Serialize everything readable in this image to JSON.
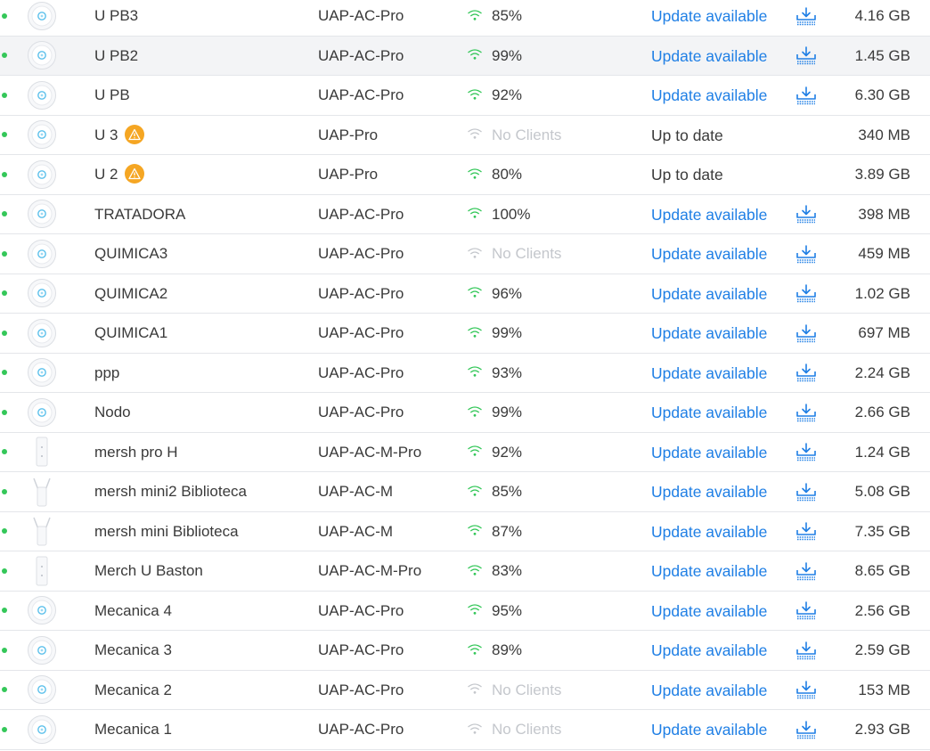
{
  "colors": {
    "online": "#34c759",
    "link": "#1f7fe5",
    "wifi_active": "#34c759",
    "wifi_empty": "#c4c7cc",
    "warning": "#f5a623",
    "row_border": "#e4e6ea",
    "row_hover": "#f3f4f6"
  },
  "devices": [
    {
      "status": "online",
      "icon": "uap-ac-pro-icon",
      "name": "U PB3",
      "warning": false,
      "model": "UAP-AC-Pro",
      "clients": "85%",
      "has_clients": true,
      "version": "Update available",
      "update": true,
      "usage": "4.16 GB"
    },
    {
      "status": "online",
      "icon": "uap-ac-pro-icon",
      "name": "U PB2",
      "warning": false,
      "model": "UAP-AC-Pro",
      "clients": "99%",
      "has_clients": true,
      "version": "Update available",
      "update": true,
      "usage": "1.45 GB",
      "hover": true
    },
    {
      "status": "online",
      "icon": "uap-ac-pro-icon",
      "name": "U PB",
      "warning": false,
      "model": "UAP-AC-Pro",
      "clients": "92%",
      "has_clients": true,
      "version": "Update available",
      "update": true,
      "usage": "6.30 GB"
    },
    {
      "status": "online",
      "icon": "uap-ac-pro-icon",
      "name": "U 3",
      "warning": true,
      "model": "UAP-Pro",
      "clients": "No Clients",
      "has_clients": false,
      "version": "Up to date",
      "update": false,
      "usage": "340 MB"
    },
    {
      "status": "online",
      "icon": "uap-ac-pro-icon",
      "name": "U 2",
      "warning": true,
      "model": "UAP-Pro",
      "clients": "80%",
      "has_clients": true,
      "version": "Up to date",
      "update": false,
      "usage": "3.89 GB"
    },
    {
      "status": "online",
      "icon": "uap-ac-pro-icon",
      "name": "TRATADORA",
      "warning": false,
      "model": "UAP-AC-Pro",
      "clients": "100%",
      "has_clients": true,
      "version": "Update available",
      "update": true,
      "usage": "398 MB"
    },
    {
      "status": "online",
      "icon": "uap-ac-pro-icon",
      "name": "QUIMICA3",
      "warning": false,
      "model": "UAP-AC-Pro",
      "clients": "No Clients",
      "has_clients": false,
      "version": "Update available",
      "update": true,
      "usage": "459 MB"
    },
    {
      "status": "online",
      "icon": "uap-ac-pro-icon",
      "name": "QUIMICA2",
      "warning": false,
      "model": "UAP-AC-Pro",
      "clients": "96%",
      "has_clients": true,
      "version": "Update available",
      "update": true,
      "usage": "1.02 GB"
    },
    {
      "status": "online",
      "icon": "uap-ac-pro-icon",
      "name": "QUIMICA1",
      "warning": false,
      "model": "UAP-AC-Pro",
      "clients": "99%",
      "has_clients": true,
      "version": "Update available",
      "update": true,
      "usage": "697 MB"
    },
    {
      "status": "online",
      "icon": "uap-ac-pro-icon",
      "name": "ppp",
      "warning": false,
      "model": "UAP-AC-Pro",
      "clients": "93%",
      "has_clients": true,
      "version": "Update available",
      "update": true,
      "usage": "2.24 GB"
    },
    {
      "status": "online",
      "icon": "uap-ac-pro-icon",
      "name": "Nodo",
      "warning": false,
      "model": "UAP-AC-Pro",
      "clients": "99%",
      "has_clients": true,
      "version": "Update available",
      "update": true,
      "usage": "2.66 GB"
    },
    {
      "status": "online",
      "icon": "uap-ac-m-pro-icon",
      "name": "mersh pro H",
      "warning": false,
      "model": "UAP-AC-M-Pro",
      "clients": "92%",
      "has_clients": true,
      "version": "Update available",
      "update": true,
      "usage": "1.24 GB"
    },
    {
      "status": "online",
      "icon": "uap-ac-m-icon",
      "name": "mersh mini2 Biblioteca",
      "warning": false,
      "model": "UAP-AC-M",
      "clients": "85%",
      "has_clients": true,
      "version": "Update available",
      "update": true,
      "usage": "5.08 GB"
    },
    {
      "status": "online",
      "icon": "uap-ac-m-icon",
      "name": "mersh mini Biblioteca",
      "warning": false,
      "model": "UAP-AC-M",
      "clients": "87%",
      "has_clients": true,
      "version": "Update available",
      "update": true,
      "usage": "7.35 GB"
    },
    {
      "status": "online",
      "icon": "uap-ac-m-pro-icon",
      "name": "Merch U Baston",
      "warning": false,
      "model": "UAP-AC-M-Pro",
      "clients": "83%",
      "has_clients": true,
      "version": "Update available",
      "update": true,
      "usage": "8.65 GB"
    },
    {
      "status": "online",
      "icon": "uap-ac-pro-icon",
      "name": "Mecanica 4",
      "warning": false,
      "model": "UAP-AC-Pro",
      "clients": "95%",
      "has_clients": true,
      "version": "Update available",
      "update": true,
      "usage": "2.56 GB"
    },
    {
      "status": "online",
      "icon": "uap-ac-pro-icon",
      "name": "Mecanica 3",
      "warning": false,
      "model": "UAP-AC-Pro",
      "clients": "89%",
      "has_clients": true,
      "version": "Update available",
      "update": true,
      "usage": "2.59 GB"
    },
    {
      "status": "online",
      "icon": "uap-ac-pro-icon",
      "name": "Mecanica 2",
      "warning": false,
      "model": "UAP-AC-Pro",
      "clients": "No Clients",
      "has_clients": false,
      "version": "Update available",
      "update": true,
      "usage": "153 MB"
    },
    {
      "status": "online",
      "icon": "uap-ac-pro-icon",
      "name": "Mecanica 1",
      "warning": false,
      "model": "UAP-AC-Pro",
      "clients": "No Clients",
      "has_clients": false,
      "version": "Update available",
      "update": true,
      "usage": "2.93 GB"
    }
  ]
}
